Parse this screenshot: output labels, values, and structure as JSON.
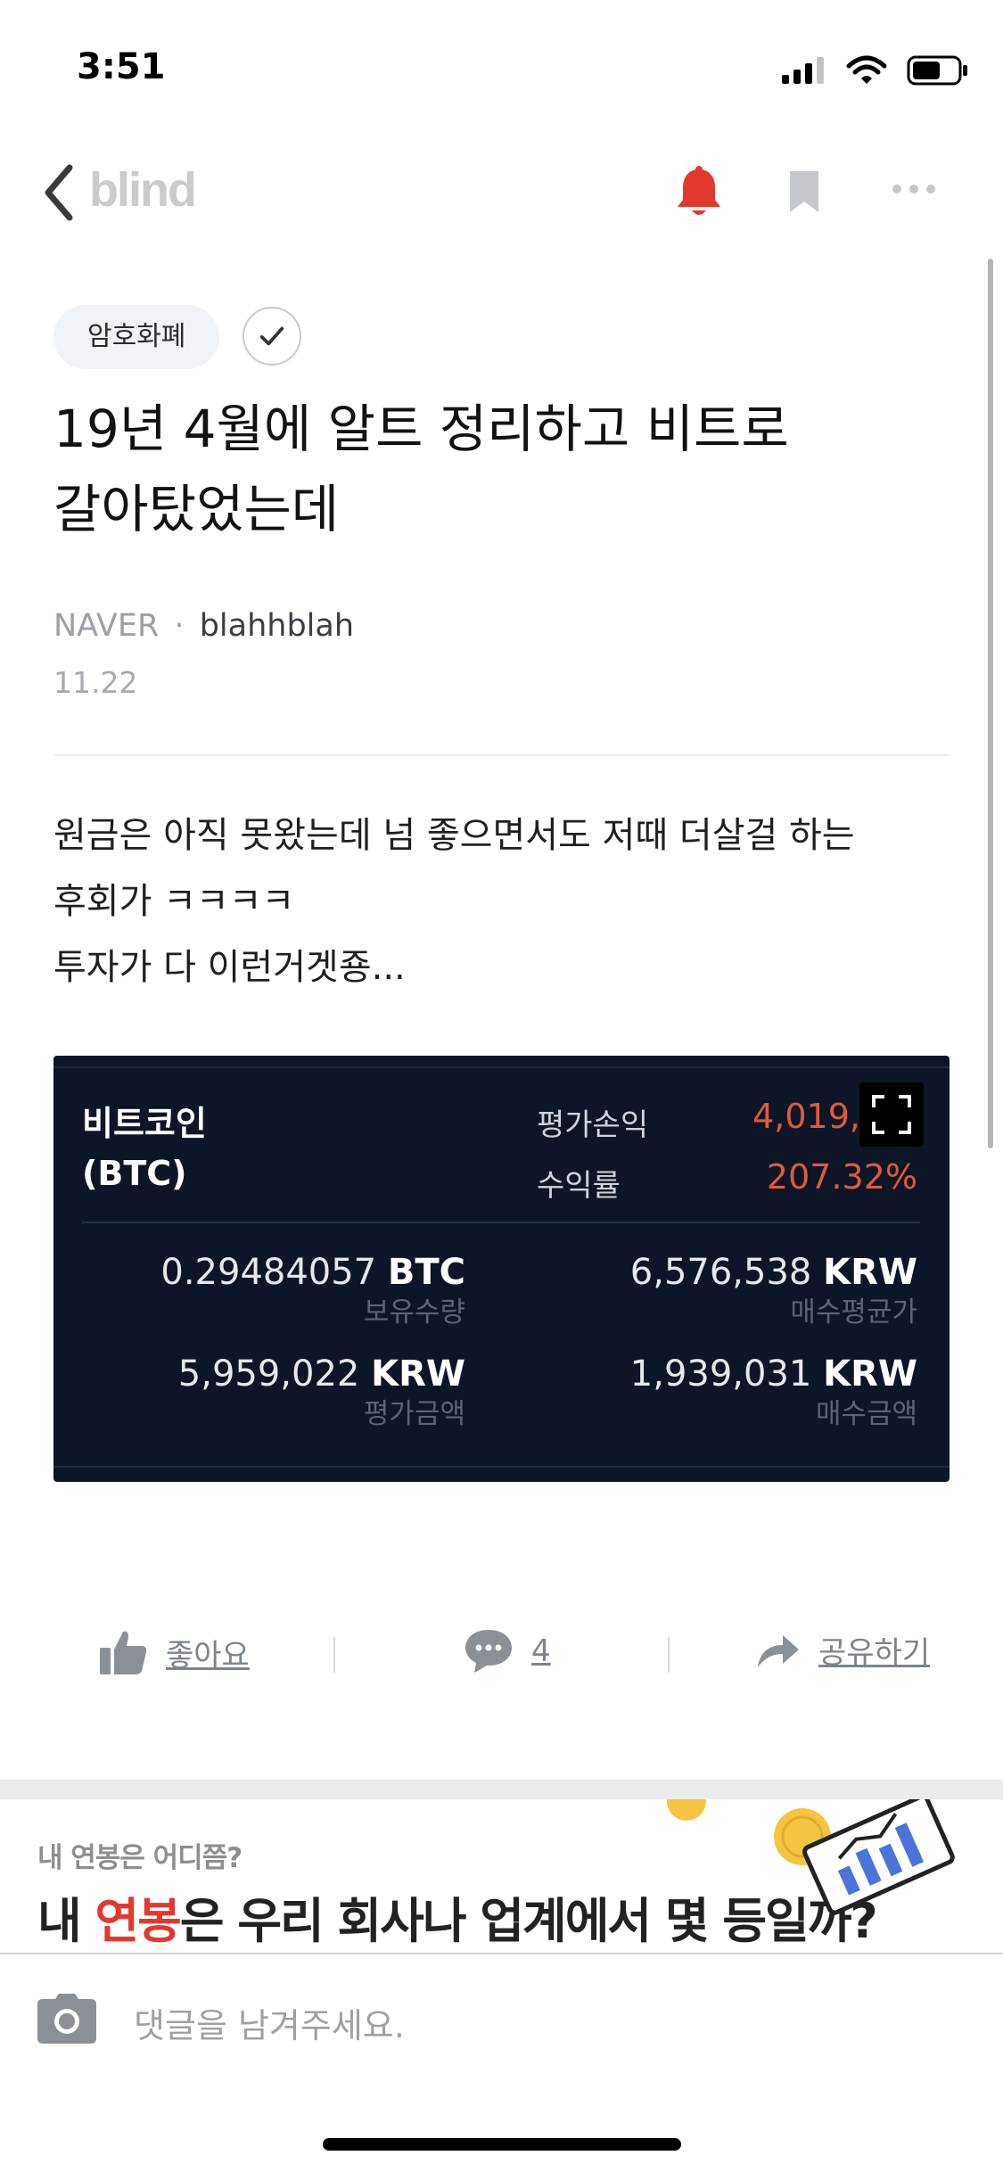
{
  "status_bar": {
    "time": "3:51"
  },
  "nav": {
    "logo": "blind"
  },
  "post": {
    "topic": "암호화폐",
    "title_lines": [
      "19년 4월에 알트 정리하고 비트로",
      "갈아탔었는데"
    ],
    "company": "NAVER",
    "separator": "·",
    "author": "blahhblah",
    "date": "11.22",
    "body_lines": [
      "원금은 아직 못왔는데 넘 좋으면서도 저때 더살걸 하는",
      "후회가 ㅋㅋㅋㅋ",
      "투자가 다 이런거겟죵..."
    ]
  },
  "crypto_card": {
    "coin_name": "비트코인",
    "coin_symbol": "(BTC)",
    "pl_label": "평가손익",
    "pl_value": "4,019,",
    "rate_label": "수익률",
    "rate_value": "207.32%",
    "holding_value": "0.29484057",
    "holding_unit": "BTC",
    "holding_label": "보유수량",
    "avg_price_value": "6,576,538",
    "avg_price_unit": "KRW",
    "avg_price_label": "매수평균가",
    "eval_value": "5,959,022",
    "eval_unit": "KRW",
    "eval_label": "평가금액",
    "buy_value": "1,939,031",
    "buy_unit": "KRW",
    "buy_label": "매수금액",
    "accent_color": "#e0593e"
  },
  "actions": {
    "like_label": "좋아요",
    "comment_count": "4",
    "share_label": "공유하기"
  },
  "banner": {
    "subtitle": "내 연봉은 어디쯤?",
    "main_prefix": "내 ",
    "main_accent": "연봉",
    "main_suffix": "은 우리 회사나 업계에서 몇 등일까?"
  },
  "comment_bar": {
    "placeholder": "댓글을 남겨주세요."
  },
  "colors": {
    "notification_bell": "#e2392f",
    "card_background": "#0d1627",
    "banner_accent": "#e2392f"
  }
}
